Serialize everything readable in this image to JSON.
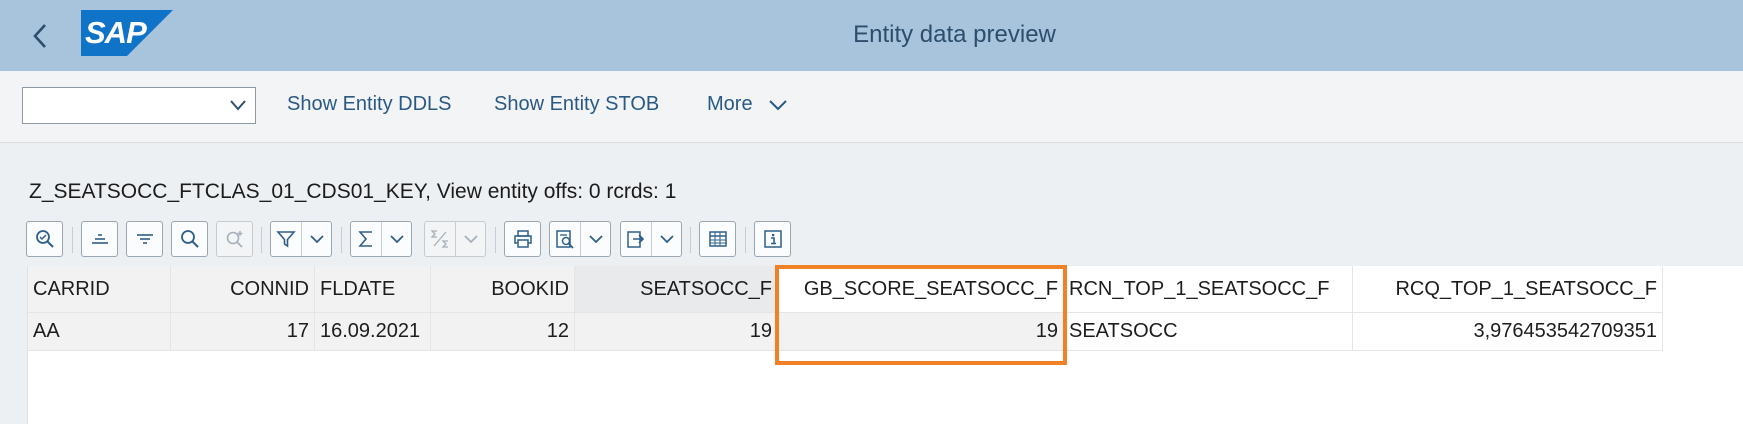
{
  "shell": {
    "title": "Entity data preview",
    "logo_text": "SAP",
    "logo_color": "#0f74c8"
  },
  "toolbar": {
    "variant_value": "",
    "show_ddls_label": "Show Entity DDLS",
    "show_stob_label": "Show Entity STOB",
    "more_label": "More"
  },
  "content": {
    "heading": "Z_SEATSOCC_FTCLAS_01_CDS01_KEY, View entity offs: 0  rcrds: 1"
  },
  "grid_toolbar": {
    "icons": [
      "details-icon",
      "sort-ascending-icon",
      "sort-descending-icon",
      "find-icon",
      "find-next-icon",
      "filter-icon",
      "total-icon",
      "subtotal-icon",
      "print-icon",
      "view-icon",
      "export-icon",
      "spreadsheet-icon",
      "info-icon"
    ]
  },
  "table": {
    "columns": [
      "CARRID",
      "CONNID",
      "FLDATE",
      "BOOKID",
      "SEATSOCC_F",
      "GB_SCORE_SEATSOCC_F",
      "RCN_TOP_1_SEATSOCC_F",
      "RCQ_TOP_1_SEATSOCC_F"
    ],
    "rows": [
      [
        "AA",
        "17",
        "16.09.2021",
        "12",
        "19",
        "19",
        "SEATSOCC",
        "3,976453542709351"
      ]
    ]
  },
  "colors": {
    "header_bar": "#a8c4dd",
    "highlight": "#f08127",
    "link": "#2a5a83"
  }
}
